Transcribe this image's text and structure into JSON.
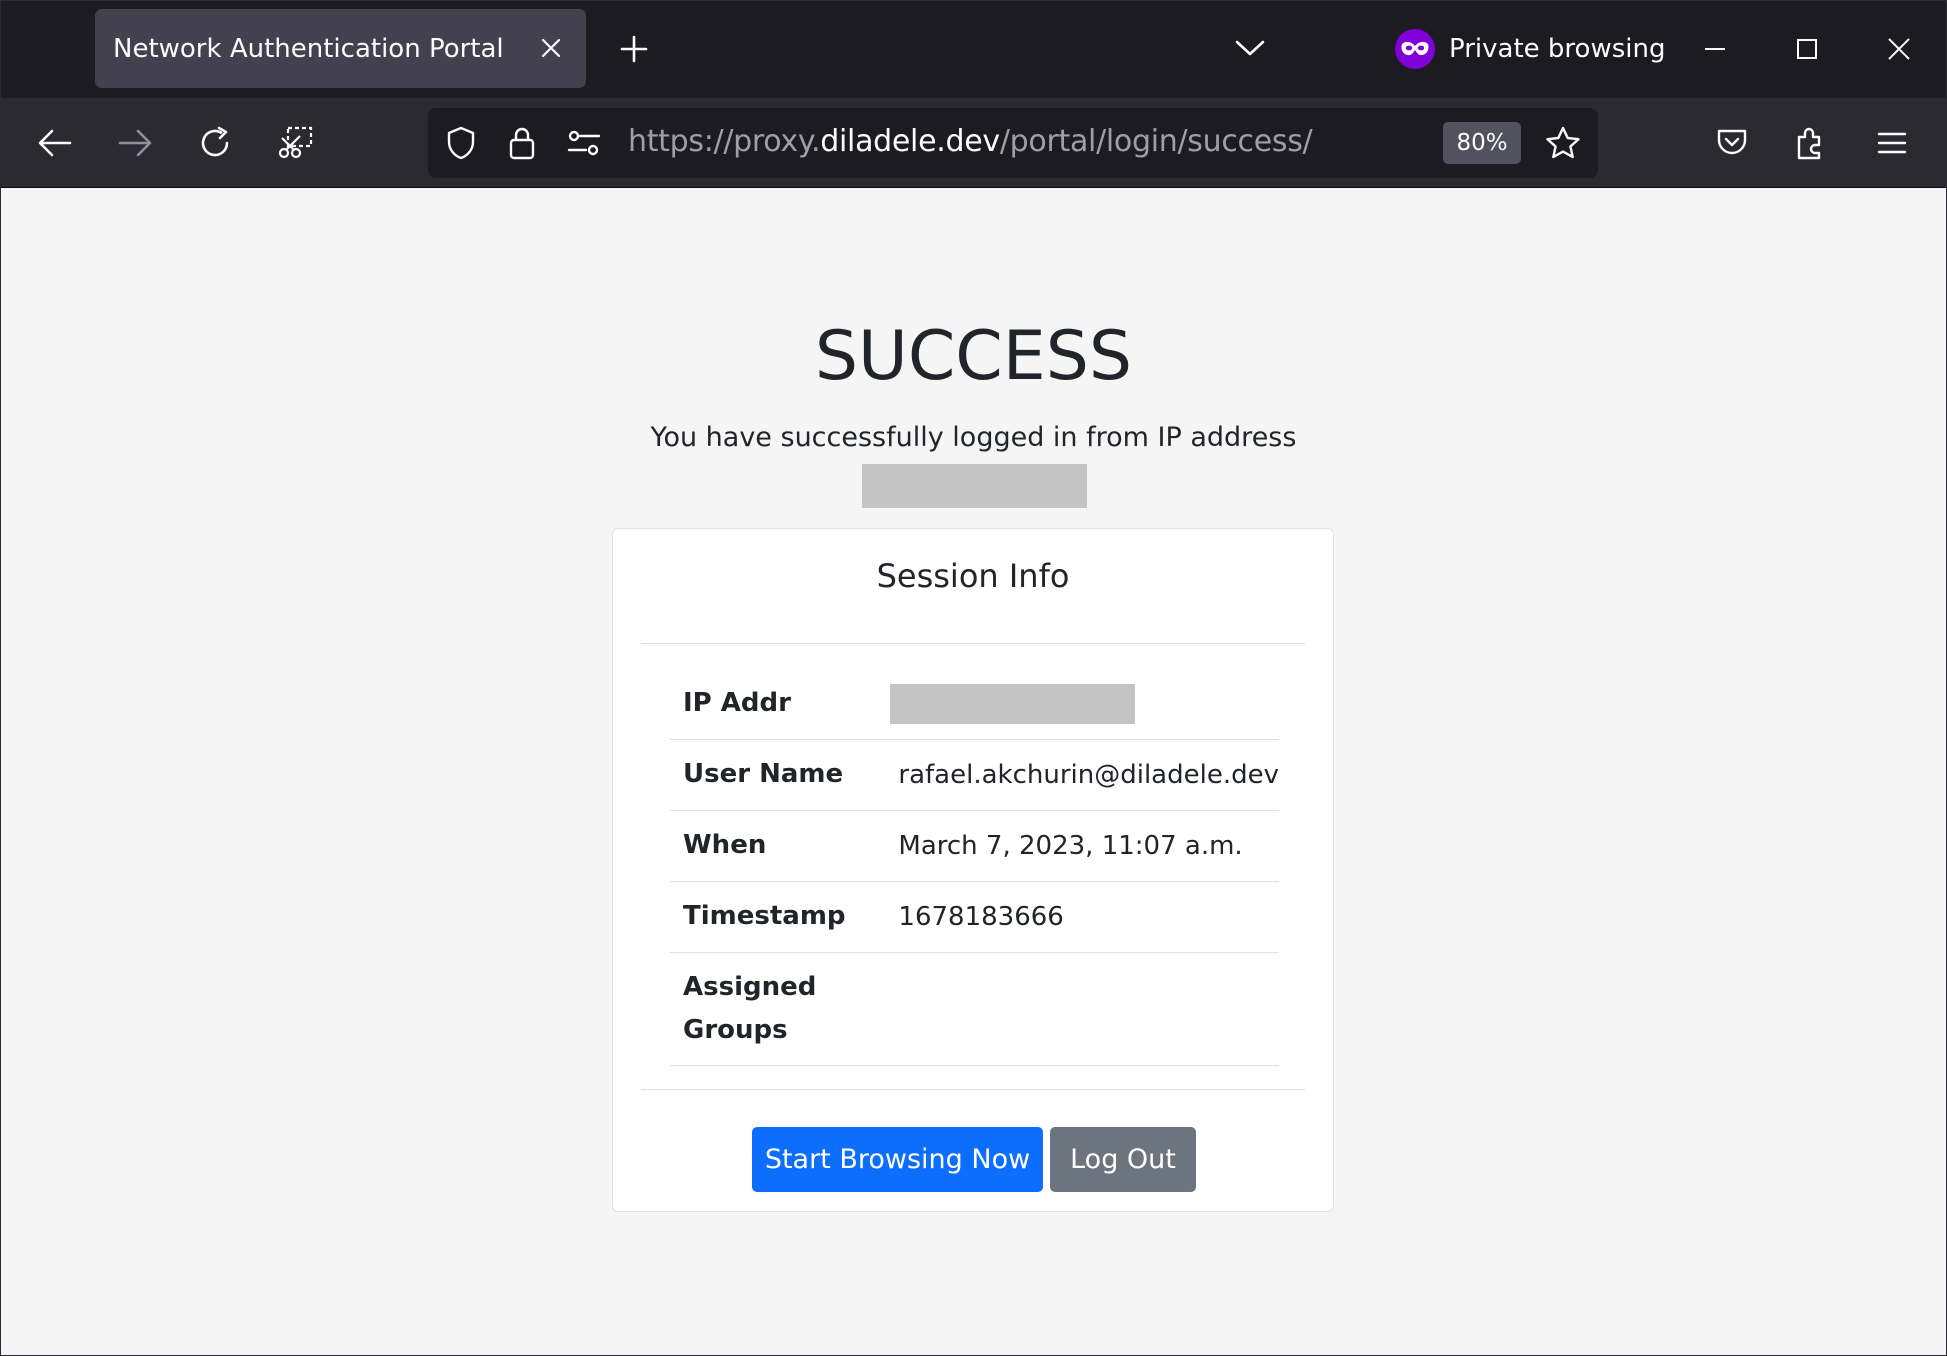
{
  "browser": {
    "tab_title": "Network Authentication Portal",
    "private_label": "Private browsing",
    "url": {
      "prefix": "https://proxy.",
      "host": "diladele.dev",
      "path": "/portal/login/success/"
    },
    "zoom": "80%"
  },
  "page": {
    "heading": "SUCCESS",
    "subline": "You have successfully logged in from IP address",
    "card": {
      "title": "Session Info",
      "rows": [
        {
          "label": "IP Addr",
          "value": ""
        },
        {
          "label": "User Name",
          "value": "rafael.akchurin@diladele.dev"
        },
        {
          "label": "When",
          "value": "March 7, 2023, 11:07 a.m."
        },
        {
          "label": "Timestamp",
          "value": "1678183666"
        },
        {
          "label": "Assigned Groups",
          "value": ""
        }
      ],
      "primary_button": "Start Browsing Now",
      "secondary_button": "Log Out"
    }
  },
  "colors": {
    "primary": "#0d6efd",
    "secondary": "#6c757d",
    "private_purple": "#8000d7"
  },
  "icons": [
    "close-icon",
    "plus-icon",
    "chevron-down-icon",
    "private-mask-icon",
    "minimize-icon",
    "maximize-icon",
    "window-close-icon",
    "back-arrow-icon",
    "forward-arrow-icon",
    "reload-icon",
    "screenshot-icon",
    "shield-icon",
    "lock-icon",
    "permissions-icon",
    "star-icon",
    "pocket-icon",
    "extensions-icon",
    "menu-icon"
  ]
}
